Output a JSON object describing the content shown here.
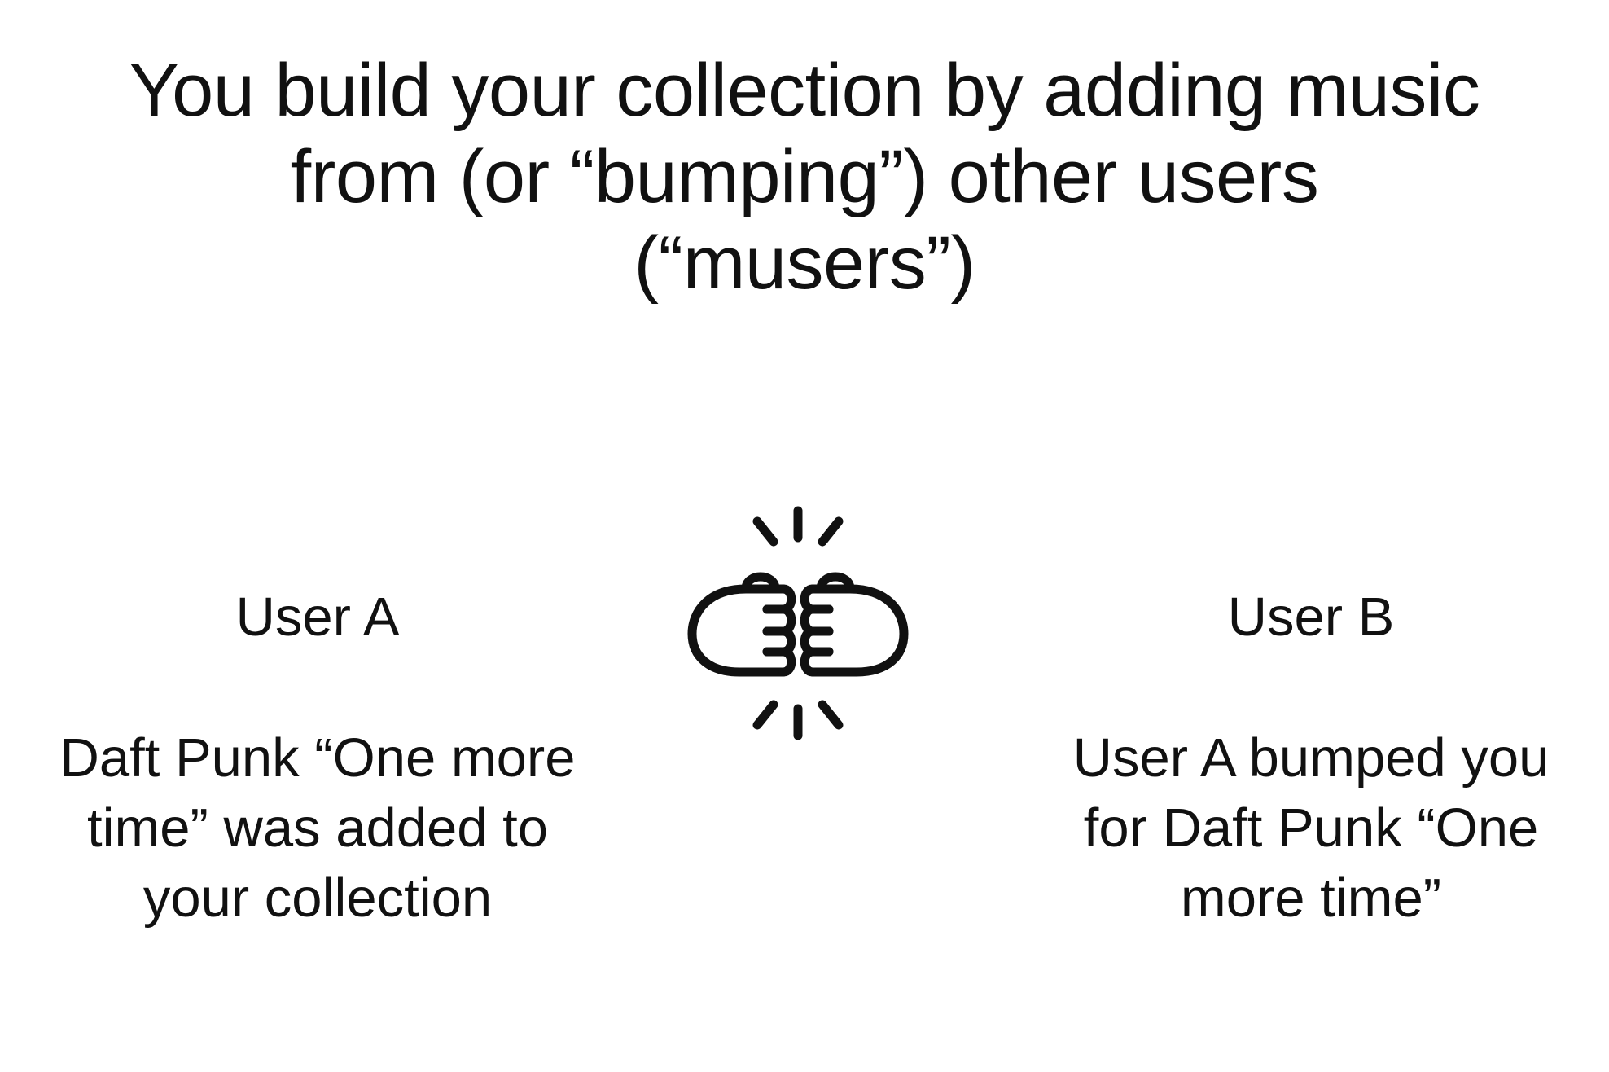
{
  "slide": {
    "title_lines": [
      "You build your collection by adding music",
      "from (or “bumping”) other users",
      "(“musers”)"
    ]
  },
  "user_a": {
    "name": "User A",
    "message_lines": [
      "Daft Punk “One more",
      "time” was added to",
      "your collection"
    ]
  },
  "user_b": {
    "name": "User B",
    "message_lines": [
      "User A bumped you",
      "for Daft Punk “One",
      "more time”"
    ]
  },
  "icons": {
    "center": "fist-bump-icon"
  },
  "colors": {
    "text": "#111111",
    "background": "#ffffff"
  }
}
